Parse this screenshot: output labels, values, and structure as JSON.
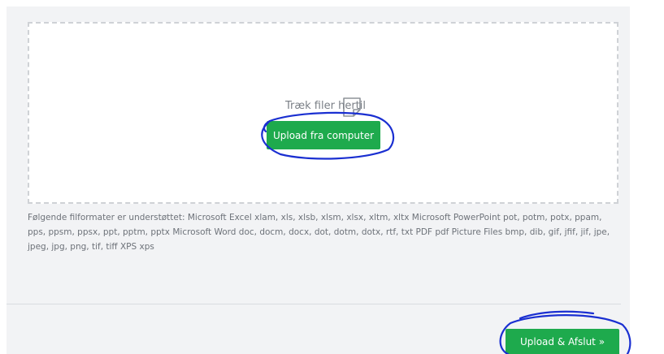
{
  "dropzone": {
    "icon": "file-icon",
    "drop_text": "Træk filer hertil",
    "upload_button_label": "Upload fra computer"
  },
  "formats_text": "Følgende filformater er understøttet: Microsoft Excel xlam, xls, xlsb, xlsm, xlsx, xltm, xltx Microsoft PowerPoint pot, potm, potx, ppam, pps, ppsm, ppsx, ppt, pptm, pptx Microsoft Word doc, docm, docx, dot, dotm, dotx, rtf, txt PDF pdf Picture Files bmp, dib, gif, jfif, jif, jpe, jpeg, jpg, png, tif, tiff XPS xps",
  "footer": {
    "finish_button_label": "Upload & Afslut »"
  },
  "colors": {
    "accent": "#1eaa4d",
    "annotation": "#1a2fd1"
  }
}
